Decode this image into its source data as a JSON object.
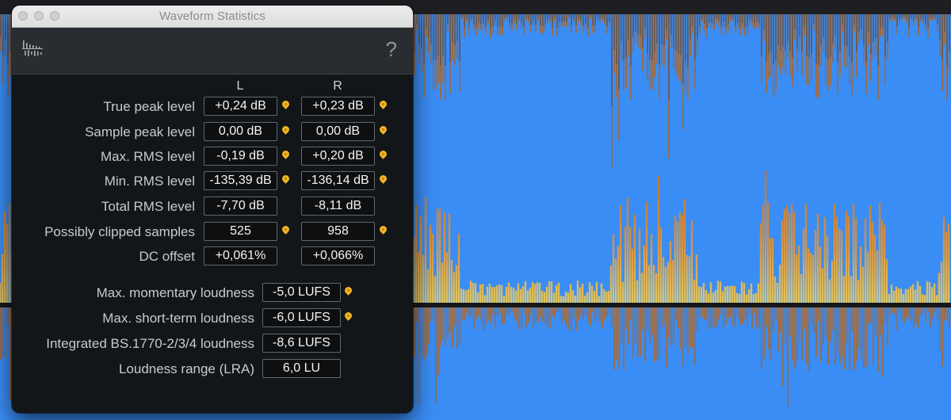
{
  "window": {
    "title": "Waveform Statistics",
    "help_label": "?",
    "toolbar_icon": "waveform-stats-icon"
  },
  "columns": {
    "left": "L",
    "right": "R"
  },
  "channel_stats": [
    {
      "label": "True peak level",
      "left": "+0,24 dB",
      "right": "+0,23 dB",
      "left_marker": true,
      "right_marker": true
    },
    {
      "label": "Sample peak level",
      "left": "0,00 dB",
      "right": "0,00 dB",
      "left_marker": true,
      "right_marker": true
    },
    {
      "label": "Max. RMS level",
      "left": "-0,19 dB",
      "right": "+0,20 dB",
      "left_marker": true,
      "right_marker": true
    },
    {
      "label": "Min. RMS level",
      "left": "-135,39 dB",
      "right": "-136,14 dB",
      "left_marker": true,
      "right_marker": true
    },
    {
      "label": "Total RMS level",
      "left": "-7,70 dB",
      "right": "-8,11 dB",
      "left_marker": false,
      "right_marker": false
    },
    {
      "label": "Possibly clipped samples",
      "left": "525",
      "right": "958",
      "left_marker": true,
      "right_marker": true
    },
    {
      "label": "DC offset",
      "left": "+0,061%",
      "right": "+0,066%",
      "left_marker": false,
      "right_marker": false
    }
  ],
  "loudness_stats": [
    {
      "label": "Max. momentary loudness",
      "value": "-5,0 LUFS",
      "marker": true
    },
    {
      "label": "Max. short-term loudness",
      "value": "-6,0 LUFS",
      "marker": true
    },
    {
      "label": "Integrated BS.1770-2/3/4 loudness",
      "value": "-8,6 LUFS",
      "marker": false
    },
    {
      "label": "Loudness range (LRA)",
      "value": "6,0 LU",
      "marker": false
    }
  ],
  "colors": {
    "waveform_blue": "#3a8df5",
    "spectrogram_orange": "#e07a1c",
    "marker_yellow": "#f1b523",
    "panel_background": "#131619"
  }
}
